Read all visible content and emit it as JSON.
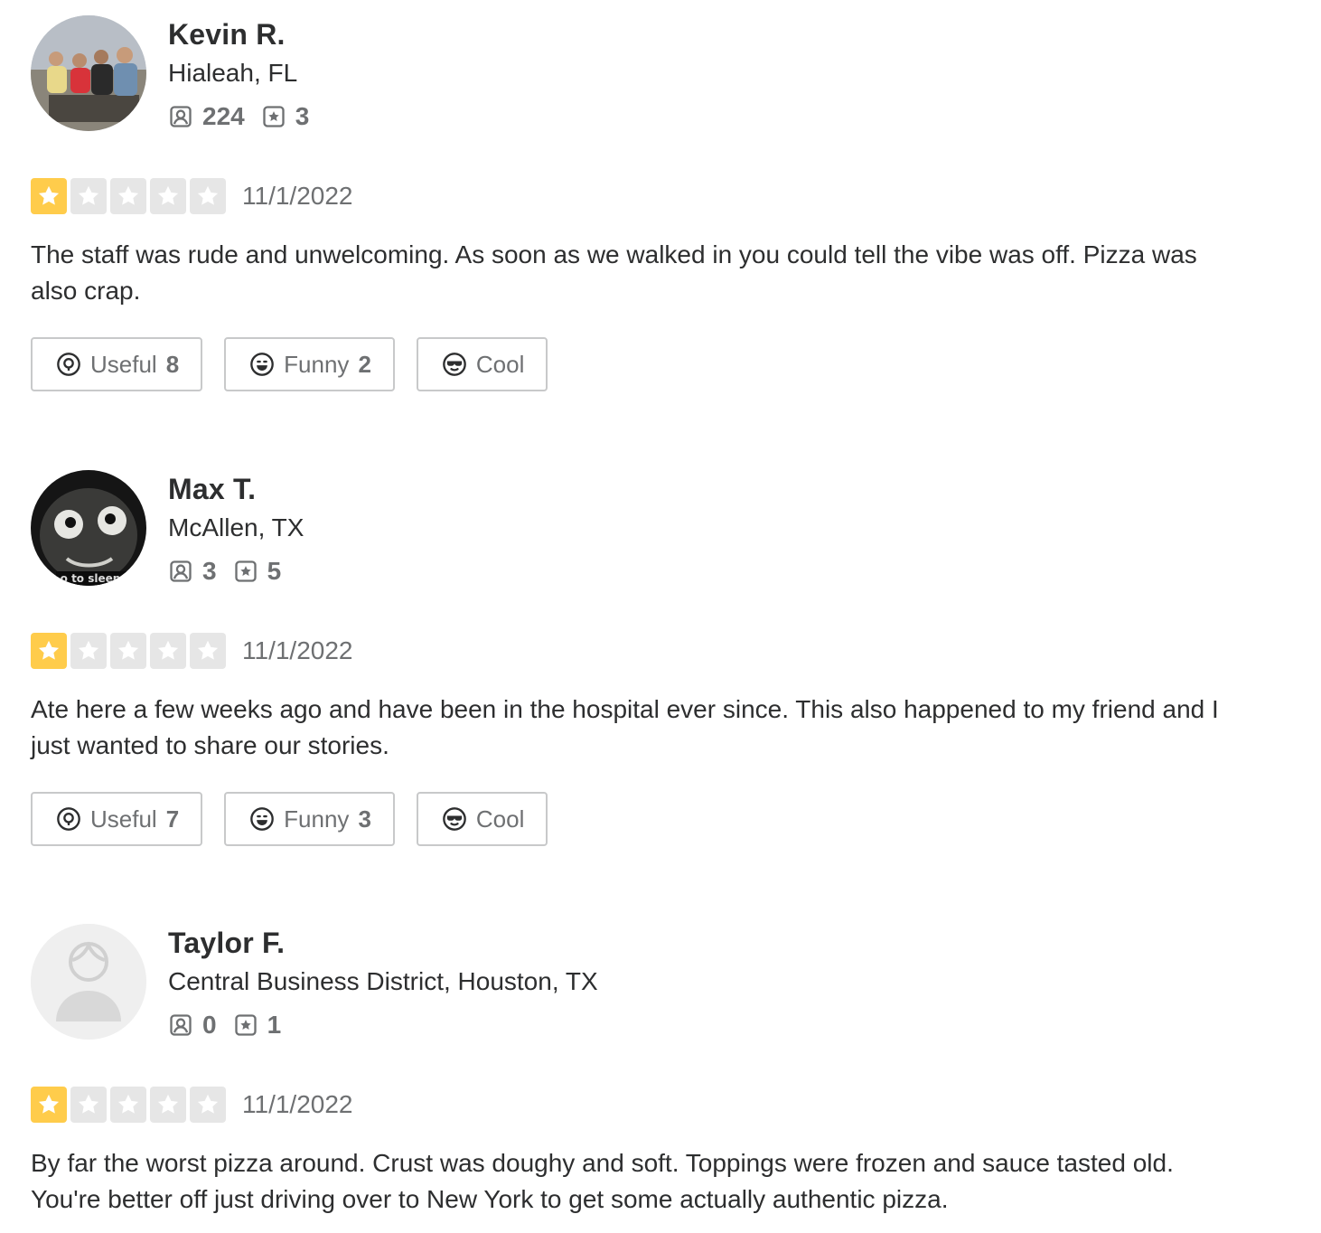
{
  "reviews": [
    {
      "name": "Kevin R.",
      "location": "Hialeah, FL",
      "friends": "224",
      "review_count": "3",
      "rating": 1,
      "date": "11/1/2022",
      "text": "The staff was rude and unwelcoming. As soon as we walked in you could tell the vibe was off.  Pizza was also crap.",
      "useful_label": "Useful",
      "useful_count": "8",
      "funny_label": "Funny",
      "funny_count": "2",
      "cool_label": "Cool",
      "avatar": "group-photo"
    },
    {
      "name": "Max T.",
      "location": "McAllen, TX",
      "friends": "3",
      "review_count": "5",
      "rating": 1,
      "date": "11/1/2022",
      "text": "Ate here a few weeks ago and have been in the hospital ever since.  This also happened to my friend and I just wanted to share our stories.",
      "useful_label": "Useful",
      "useful_count": "7",
      "funny_label": "Funny",
      "funny_count": "3",
      "cool_label": "Cool",
      "avatar": "dark-face-photo"
    },
    {
      "name": "Taylor F.",
      "location": "Central Business District, Houston, TX",
      "friends": "0",
      "review_count": "1",
      "rating": 1,
      "date": "11/1/2022",
      "text": "By far the worst pizza around. Crust was doughy and soft. Toppings were frozen and sauce tasted old. You're better off just driving over to New York to get some actually authentic pizza.",
      "avatar": "default-avatar"
    }
  ],
  "icons": {
    "friends": "friends-icon",
    "reviews": "review-star-icon",
    "useful": "useful-icon",
    "funny": "funny-icon",
    "cool": "cool-icon",
    "star": "star-icon"
  },
  "colors": {
    "star_on": "#ffcc4b",
    "star_off": "#e6e6e6",
    "text": "#2d2e2f",
    "muted": "#6e7072",
    "border": "#c8c9ca"
  }
}
